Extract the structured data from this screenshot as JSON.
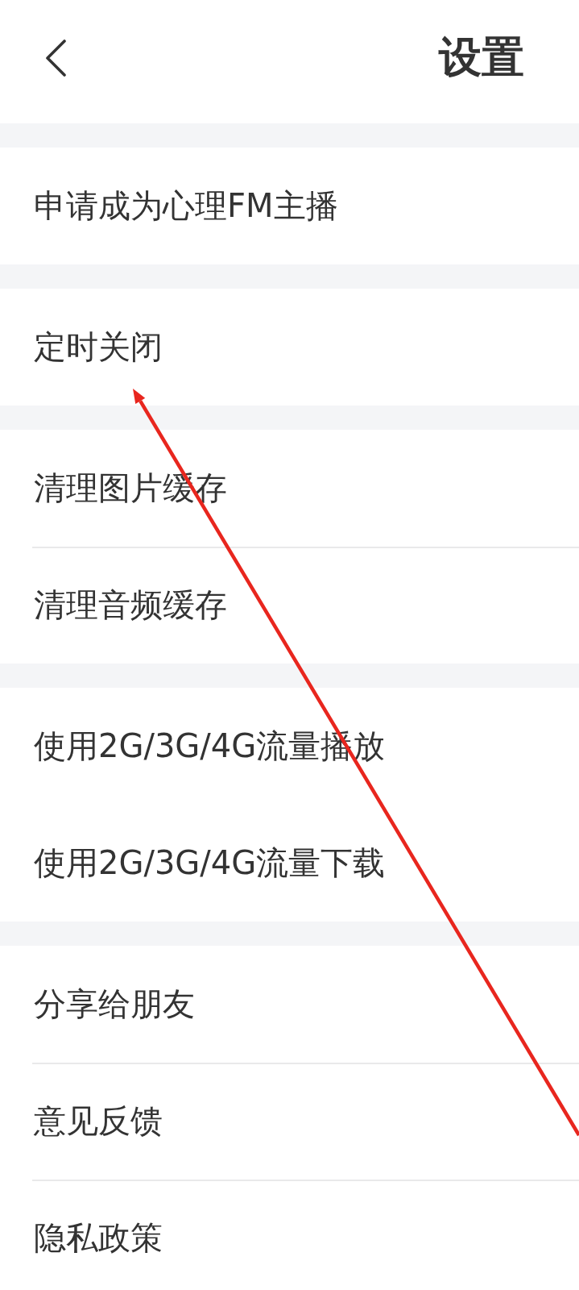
{
  "header": {
    "title": "设置"
  },
  "sections": [
    {
      "items": [
        {
          "label": "申请成为心理FM主播",
          "divider_above": false
        }
      ]
    },
    {
      "items": [
        {
          "label": "定时关闭",
          "divider_above": false
        }
      ]
    },
    {
      "items": [
        {
          "label": "清理图片缓存",
          "divider_above": false
        },
        {
          "label": "清理音频缓存",
          "divider_above": true
        }
      ]
    },
    {
      "items": [
        {
          "label": "使用2G/3G/4G流量播放",
          "divider_above": false
        },
        {
          "label": "使用2G/3G/4G流量下载",
          "divider_above": false
        }
      ]
    },
    {
      "items": [
        {
          "label": "分享给朋友",
          "divider_above": false
        },
        {
          "label": "意见反馈",
          "divider_above": true
        },
        {
          "label": "隐私政策",
          "divider_above": true
        }
      ]
    }
  ],
  "annotation": {
    "kind": "arrow"
  }
}
